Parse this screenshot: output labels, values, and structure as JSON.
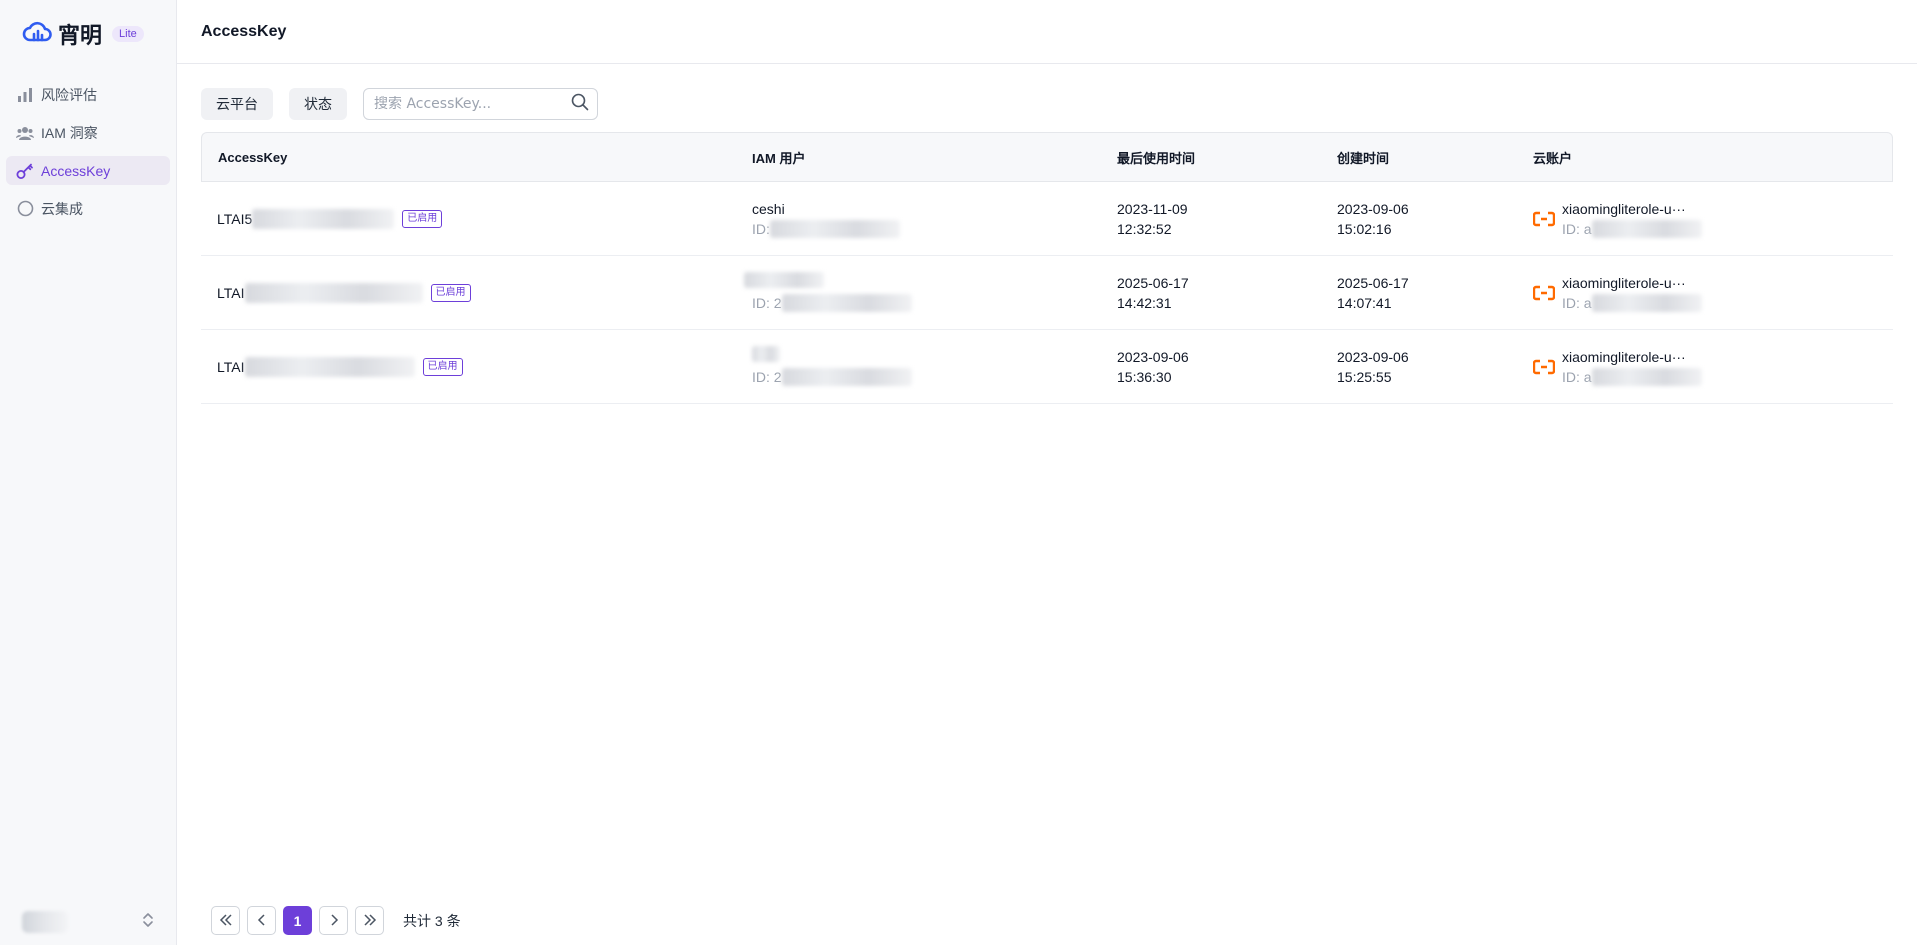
{
  "app": {
    "name": "宵明",
    "badge": "Lite"
  },
  "sidebar": {
    "items": [
      {
        "label": "风险评估",
        "icon": "bar-chart-icon",
        "active": false
      },
      {
        "label": "IAM 洞察",
        "icon": "users-icon",
        "active": false
      },
      {
        "label": "AccessKey",
        "icon": "key-icon",
        "active": true
      },
      {
        "label": "云集成",
        "icon": "circle-icon",
        "active": false
      }
    ]
  },
  "header": {
    "title": "AccessKey"
  },
  "filters": {
    "platform_label": "云平台",
    "status_label": "状态",
    "search_placeholder": "搜索 AccessKey...",
    "search_value": ""
  },
  "table": {
    "columns": [
      "AccessKey",
      "IAM 用户",
      "最后使用时间",
      "创建时间",
      "云账户"
    ],
    "rows": [
      {
        "ak_prefix": "LTAI5",
        "status": "已启用",
        "user_name": "ceshi",
        "user_id_prefix": "ID: ",
        "last_used_date": "2023-11-09",
        "last_used_time": "12:32:52",
        "created_date": "2023-09-06",
        "created_time": "15:02:16",
        "account_name": "xiaomingliterole-u···",
        "account_id_prefix": "ID: a"
      },
      {
        "ak_prefix": "LTAI",
        "status": "已启用",
        "user_name": "",
        "user_id_prefix": "ID: 2",
        "last_used_date": "2025-06-17",
        "last_used_time": "14:42:31",
        "created_date": "2025-06-17",
        "created_time": "14:07:41",
        "account_name": "xiaomingliterole-u···",
        "account_id_prefix": "ID: a"
      },
      {
        "ak_prefix": "LTAI",
        "status": "已启用",
        "user_name": "",
        "user_id_prefix": "ID: 2",
        "last_used_date": "2023-09-06",
        "last_used_time": "15:36:30",
        "created_date": "2023-09-06",
        "created_time": "15:25:55",
        "account_name": "xiaomingliterole-u···",
        "account_id_prefix": "ID: a"
      }
    ]
  },
  "pagination": {
    "current_page": "1",
    "total_text": "共计 3 条"
  },
  "colors": {
    "accent": "#6d3fd9",
    "aliyun_orange": "#ff6a00"
  }
}
